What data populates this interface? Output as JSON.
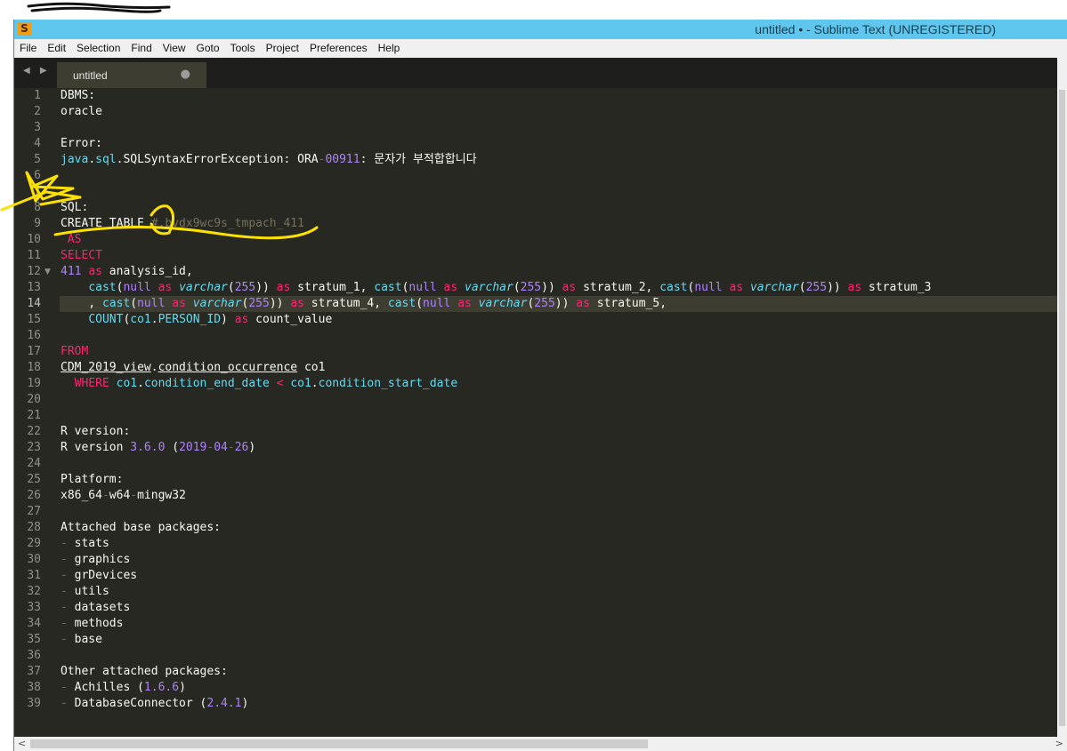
{
  "window": {
    "title": "untitled • - Sublime Text (UNREGISTERED)",
    "app_icon": "S"
  },
  "menu": [
    "File",
    "Edit",
    "Selection",
    "Find",
    "View",
    "Goto",
    "Tools",
    "Project",
    "Preferences",
    "Help"
  ],
  "tab": {
    "nav_icon": "◀ ▶",
    "label": "untitled",
    "dirty_marker": "●"
  },
  "editor": {
    "current_line": 14,
    "lines": [
      {
        "n": 1,
        "tokens": [
          [
            "p",
            "DBMS:"
          ]
        ]
      },
      {
        "n": 2,
        "tokens": [
          [
            "p",
            "oracle"
          ]
        ]
      },
      {
        "n": 3,
        "tokens": []
      },
      {
        "n": 4,
        "tokens": [
          [
            "p",
            "Error:"
          ]
        ]
      },
      {
        "n": 5,
        "tokens": [
          [
            "f",
            "java"
          ],
          [
            "p",
            "."
          ],
          [
            "f",
            "sql"
          ],
          [
            "p",
            ".SQLSyntaxErrorException: ORA"
          ],
          [
            "k",
            "-"
          ],
          [
            "n",
            "00911"
          ],
          [
            "p",
            ": 문자가 부적합합니다"
          ]
        ]
      },
      {
        "n": 6,
        "tokens": []
      },
      {
        "n": 7,
        "tokens": []
      },
      {
        "n": 8,
        "tokens": [
          [
            "p",
            "SQL:"
          ]
        ]
      },
      {
        "n": 9,
        "tokens": [
          [
            "p",
            "CREATE TABLE "
          ],
          [
            "c",
            "#.bvdx9wc9s_tmpach_411"
          ]
        ]
      },
      {
        "n": 10,
        "tokens": [
          [
            "k",
            " AS"
          ]
        ]
      },
      {
        "n": 11,
        "tokens": [
          [
            "k",
            "SELECT"
          ]
        ]
      },
      {
        "n": 12,
        "fold": true,
        "tokens": [
          [
            "n",
            "411"
          ],
          [
            "p",
            " "
          ],
          [
            "k",
            "as"
          ],
          [
            "p",
            " analysis_id,"
          ]
        ]
      },
      {
        "n": 13,
        "tokens": [
          [
            "p",
            "    "
          ],
          [
            "f",
            "cast"
          ],
          [
            "p",
            "("
          ],
          [
            "n",
            "null"
          ],
          [
            "p",
            " "
          ],
          [
            "k",
            "as"
          ],
          [
            "p",
            " "
          ],
          [
            "t",
            "varchar"
          ],
          [
            "p",
            "("
          ],
          [
            "n",
            "255"
          ],
          [
            "p",
            ")) "
          ],
          [
            "k",
            "as"
          ],
          [
            "p",
            " stratum_1, "
          ],
          [
            "f",
            "cast"
          ],
          [
            "p",
            "("
          ],
          [
            "n",
            "null"
          ],
          [
            "p",
            " "
          ],
          [
            "k",
            "as"
          ],
          [
            "p",
            " "
          ],
          [
            "t",
            "varchar"
          ],
          [
            "p",
            "("
          ],
          [
            "n",
            "255"
          ],
          [
            "p",
            ")) "
          ],
          [
            "k",
            "as"
          ],
          [
            "p",
            " stratum_2, "
          ],
          [
            "f",
            "cast"
          ],
          [
            "p",
            "("
          ],
          [
            "n",
            "null"
          ],
          [
            "p",
            " "
          ],
          [
            "k",
            "as"
          ],
          [
            "p",
            " "
          ],
          [
            "t",
            "varchar"
          ],
          [
            "p",
            "("
          ],
          [
            "n",
            "255"
          ],
          [
            "p",
            ")) "
          ],
          [
            "k",
            "as"
          ],
          [
            "p",
            " stratum_3"
          ]
        ]
      },
      {
        "n": 14,
        "tokens": [
          [
            "p",
            "    , "
          ],
          [
            "f",
            "cast"
          ],
          [
            "p",
            "("
          ],
          [
            "n",
            "null"
          ],
          [
            "p",
            " "
          ],
          [
            "k",
            "as"
          ],
          [
            "p",
            " "
          ],
          [
            "t",
            "varchar"
          ],
          [
            "p",
            "("
          ],
          [
            "n",
            "255"
          ],
          [
            "p",
            ")) "
          ],
          [
            "k",
            "as"
          ],
          [
            "p",
            " stratum_4, "
          ],
          [
            "f",
            "cast"
          ],
          [
            "p",
            "("
          ],
          [
            "n",
            "null"
          ],
          [
            "p",
            " "
          ],
          [
            "k",
            "as"
          ],
          [
            "p",
            " "
          ],
          [
            "t",
            "varchar"
          ],
          [
            "p",
            "("
          ],
          [
            "n",
            "255"
          ],
          [
            "p",
            ")) "
          ],
          [
            "k",
            "as"
          ],
          [
            "p",
            " stratum_5,"
          ]
        ]
      },
      {
        "n": 15,
        "tokens": [
          [
            "p",
            "    "
          ],
          [
            "f",
            "COUNT"
          ],
          [
            "p",
            "("
          ],
          [
            "f",
            "co1"
          ],
          [
            "p",
            "."
          ],
          [
            "f",
            "PERSON_ID"
          ],
          [
            "p",
            ") "
          ],
          [
            "k",
            "as"
          ],
          [
            "p",
            " count_value"
          ]
        ]
      },
      {
        "n": 16,
        "tokens": []
      },
      {
        "n": 17,
        "tokens": [
          [
            "k",
            "FROM"
          ]
        ]
      },
      {
        "n": 18,
        "tokens": [
          [
            "u",
            "CDM_2019_view"
          ],
          [
            "p",
            "."
          ],
          [
            "u",
            "condition_occurrence"
          ],
          [
            "p",
            " co1"
          ]
        ]
      },
      {
        "n": 19,
        "tokens": [
          [
            "k",
            "  WHERE"
          ],
          [
            "p",
            " "
          ],
          [
            "f",
            "co1"
          ],
          [
            "p",
            "."
          ],
          [
            "f",
            "condition_end_date"
          ],
          [
            "p",
            " "
          ],
          [
            "k",
            "<"
          ],
          [
            "p",
            " "
          ],
          [
            "f",
            "co1"
          ],
          [
            "p",
            "."
          ],
          [
            "f",
            "condition_start_date"
          ]
        ]
      },
      {
        "n": 20,
        "tokens": []
      },
      {
        "n": 21,
        "tokens": []
      },
      {
        "n": 22,
        "tokens": [
          [
            "p",
            "R version:"
          ]
        ]
      },
      {
        "n": 23,
        "tokens": [
          [
            "p",
            "R version "
          ],
          [
            "n",
            "3.6.0"
          ],
          [
            "p",
            " ("
          ],
          [
            "n",
            "2019"
          ],
          [
            "k",
            "-"
          ],
          [
            "n",
            "04"
          ],
          [
            "k",
            "-"
          ],
          [
            "n",
            "26"
          ],
          [
            "p",
            ")"
          ]
        ]
      },
      {
        "n": 24,
        "tokens": []
      },
      {
        "n": 25,
        "tokens": [
          [
            "p",
            "Platform:"
          ]
        ]
      },
      {
        "n": 26,
        "tokens": [
          [
            "p",
            "x86_64"
          ],
          [
            "k",
            "-"
          ],
          [
            "p",
            "w64"
          ],
          [
            "k",
            "-"
          ],
          [
            "p",
            "mingw32"
          ]
        ]
      },
      {
        "n": 27,
        "tokens": []
      },
      {
        "n": 28,
        "tokens": [
          [
            "p",
            "Attached base packages:"
          ]
        ]
      },
      {
        "n": 29,
        "tokens": [
          [
            "k",
            "-"
          ],
          [
            "p",
            " stats"
          ]
        ]
      },
      {
        "n": 30,
        "tokens": [
          [
            "k",
            "-"
          ],
          [
            "p",
            " graphics"
          ]
        ]
      },
      {
        "n": 31,
        "tokens": [
          [
            "k",
            "-"
          ],
          [
            "p",
            " grDevices"
          ]
        ]
      },
      {
        "n": 32,
        "tokens": [
          [
            "k",
            "-"
          ],
          [
            "p",
            " utils"
          ]
        ]
      },
      {
        "n": 33,
        "tokens": [
          [
            "k",
            "-"
          ],
          [
            "p",
            " datasets"
          ]
        ]
      },
      {
        "n": 34,
        "tokens": [
          [
            "k",
            "-"
          ],
          [
            "p",
            " methods"
          ]
        ]
      },
      {
        "n": 35,
        "tokens": [
          [
            "k",
            "-"
          ],
          [
            "p",
            " base"
          ]
        ]
      },
      {
        "n": 36,
        "tokens": []
      },
      {
        "n": 37,
        "tokens": [
          [
            "p",
            "Other attached packages:"
          ]
        ]
      },
      {
        "n": 38,
        "tokens": [
          [
            "k",
            "-"
          ],
          [
            "p",
            " Achilles ("
          ],
          [
            "n",
            "1.6.6"
          ],
          [
            "p",
            ")"
          ]
        ]
      },
      {
        "n": 39,
        "tokens": [
          [
            "k",
            "-"
          ],
          [
            "p",
            " DatabaseConnector ("
          ],
          [
            "n",
            "2.4.1"
          ],
          [
            "p",
            ")"
          ]
        ]
      }
    ]
  },
  "scrollbars": {
    "left_arrow": "<",
    "right_arrow": ">"
  },
  "colors": {
    "background": "#272822",
    "titlebar": "#5fc6ee",
    "keyword": "#f92672",
    "number": "#ae81ff",
    "function": "#66d9ef",
    "annotation": "#ffe100"
  }
}
